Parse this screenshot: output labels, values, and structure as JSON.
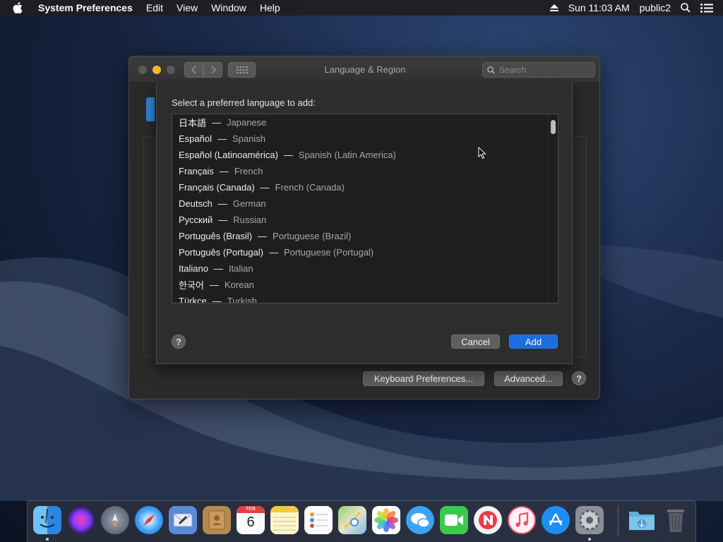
{
  "menubar": {
    "app_name": "System Preferences",
    "items": [
      "Edit",
      "View",
      "Window",
      "Help"
    ],
    "clock": "Sun 11:03 AM",
    "user": "public2"
  },
  "window": {
    "title": "Language & Region",
    "search_placeholder": "Search",
    "keyboard_prefs_label": "Keyboard Preferences...",
    "advanced_label": "Advanced...",
    "help_label": "?"
  },
  "sheet": {
    "prompt": "Select a preferred language to add:",
    "languages": [
      {
        "native": "日本語",
        "english": "Japanese"
      },
      {
        "native": "Español",
        "english": "Spanish"
      },
      {
        "native": "Español (Latinoamérica)",
        "english": "Spanish (Latin America)"
      },
      {
        "native": "Français",
        "english": "French"
      },
      {
        "native": "Français (Canada)",
        "english": "French (Canada)"
      },
      {
        "native": "Deutsch",
        "english": "German"
      },
      {
        "native": "Русский",
        "english": "Russian"
      },
      {
        "native": "Português (Brasil)",
        "english": "Portuguese (Brazil)"
      },
      {
        "native": "Português (Portugal)",
        "english": "Portuguese (Portugal)"
      },
      {
        "native": "Italiano",
        "english": "Italian"
      },
      {
        "native": "한국어",
        "english": "Korean"
      },
      {
        "native": "Türkçe",
        "english": "Turkish"
      }
    ],
    "separator": "—",
    "help_label": "?",
    "cancel_label": "Cancel",
    "add_label": "Add"
  },
  "dock": {
    "calendar_month": "FEB",
    "calendar_day": "6",
    "apps": [
      "finder",
      "siri",
      "launchpad",
      "safari",
      "mail",
      "contacts",
      "calendar",
      "notes",
      "reminders",
      "maps",
      "photos",
      "messages",
      "facetime",
      "news",
      "itunes",
      "app-store",
      "system-preferences",
      "downloads",
      "trash"
    ]
  },
  "colors": {
    "accent_blue": "#1a6ee0",
    "minimize_yellow": "#f5b72e"
  }
}
